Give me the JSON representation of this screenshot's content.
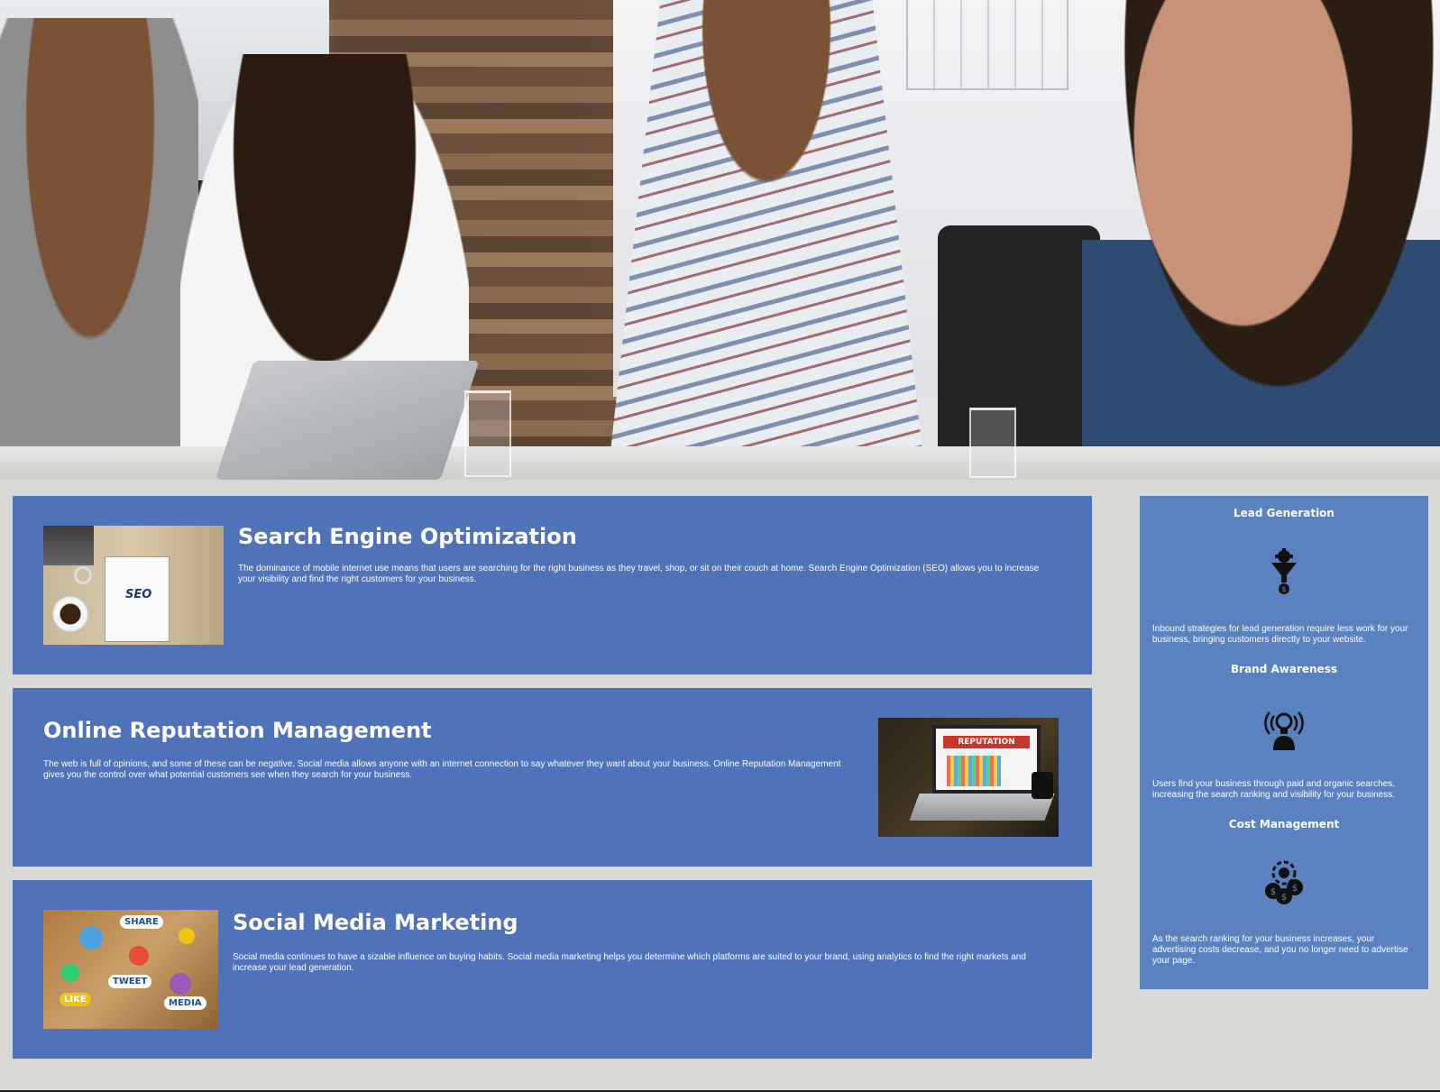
{
  "hero": {
    "image_description_icon": "team-meeting-photo"
  },
  "services": [
    {
      "title": "Search Engine Optimization",
      "text": "The dominance of mobile internet use means that users are searching for the right business as they travel, shop, or sit on their couch at home. Search Engine Optimization (SEO) allows you to increase your visibility and find the right customers for your business.",
      "thumb_label": "SEO"
    },
    {
      "title": "Online Reputation Management",
      "text": "The web is full of opinions, and some of these can be negative. Social media allows anyone with an internet connection to say whatever they want about your business. Online Reputation Management gives you the control over what potential customers see when they search for your business.",
      "thumb_label": "REPUTATION"
    },
    {
      "title": "Social Media Marketing",
      "text": "Social media continues to have a sizable influence on buying habits. Social media marketing helps you determine which platforms are suited to your brand, using analytics to find the right markets and increase your lead generation.",
      "thumb_tags": [
        "SHARE",
        "TWEET",
        "LIKE",
        "MEDIA"
      ]
    }
  ],
  "benefits": [
    {
      "title": "Lead Generation",
      "icon": "funnel-icon",
      "text": "Inbound strategies for lead generation require less work for your business, bringing customers directly to your website."
    },
    {
      "title": "Brand Awareness",
      "icon": "lightbulb-person-icon",
      "text": "Users find your business through paid and organic searches, increasing the search ranking and visibility for your business."
    },
    {
      "title": "Cost Management",
      "icon": "money-gear-icon",
      "text": "As the search ranking for your business increases, your advertising costs decrease, and you no longer need to advertise your page."
    }
  ],
  "colors": {
    "panel": "#5072b8",
    "sidebar": "#5b82bf",
    "page_bg": "#d9d9d6",
    "text": "#ffffff"
  }
}
